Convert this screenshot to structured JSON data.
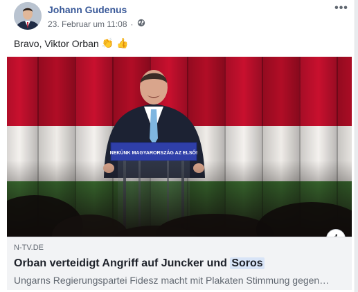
{
  "post": {
    "author": "Johann Gudenus",
    "date": "23. Februar um 11:08",
    "separator": "·",
    "audience_icon": "globe-icon",
    "more_icon": "more-options-icon",
    "more_label": "•••",
    "text": "Bravo, Viktor Orban",
    "emojis": [
      "👏",
      "👍"
    ]
  },
  "link_preview": {
    "domain": "N-TV.DE",
    "title_main": "Orban verteidigt Angriff auf Juncker und ",
    "title_highlight": "Soros",
    "description": "Ungarns Regierungspartei Fidesz macht mit Plakaten Stimmung gegen…",
    "info_label": "i",
    "image": {
      "podium_sign": "NEKÜNK MAGYARORSZÁG AZ ELSŐ!",
      "flag_colors": [
        "#c8102e",
        "#ffffff",
        "#3f7d34"
      ]
    }
  }
}
